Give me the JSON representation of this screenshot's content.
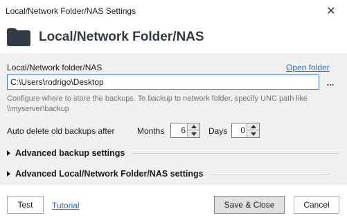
{
  "window": {
    "title": "Local/Network Folder/NAS Settings",
    "close_glyph": "✕"
  },
  "header": {
    "icon": "folder-icon",
    "heading": "Local/Network Folder/NAS"
  },
  "folder": {
    "label": "Local/Network folder/NAS",
    "open_link": "Open folder",
    "path_value": "C:\\Users\\rodrigo\\Desktop",
    "browse_label": "...",
    "hint": "Configure where to store the backups. To backup to network folder, specify UNC path like \\\\myserver\\backup"
  },
  "auto_delete": {
    "label": "Auto delete old backups after",
    "months_label": "Months",
    "months_value": "6",
    "days_label": "Days",
    "days_value": "0"
  },
  "sections": {
    "advanced_backup": "Advanced backup settings",
    "advanced_nas": "Advanced Local/Network Folder/NAS settings"
  },
  "footer": {
    "test_label": "Test",
    "tutorial_label": "Tutorial",
    "save_close_label": "Save & Close",
    "cancel_label": "Cancel"
  },
  "colors": {
    "accent": "#3a7bd5",
    "link": "#2b6cc4",
    "content_bg": "#f0f0f0"
  }
}
